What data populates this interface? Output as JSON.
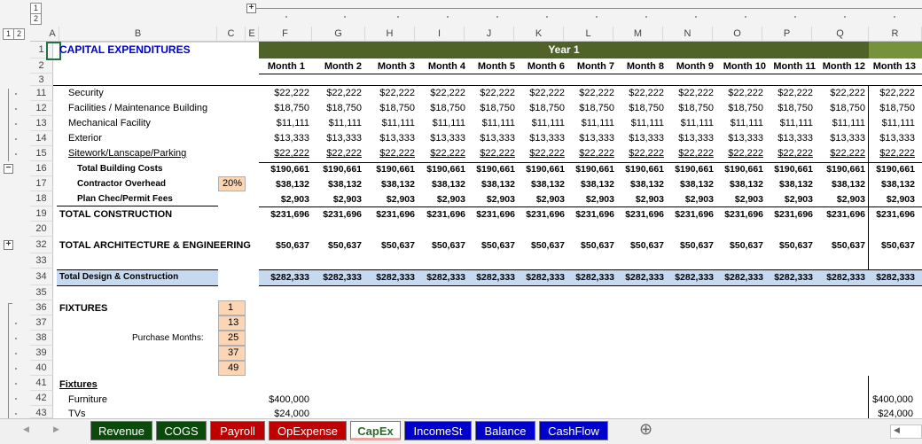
{
  "outline": {
    "col_levels": [
      "1",
      "2"
    ],
    "row_levels": [
      "1",
      "2"
    ],
    "expand": "+",
    "collapse": "−"
  },
  "columns": {
    "letters": [
      "A",
      "B",
      "C",
      "E",
      "F",
      "G",
      "H",
      "I",
      "J",
      "K",
      "L",
      "M",
      "N",
      "O",
      "P",
      "Q",
      "R"
    ]
  },
  "header": {
    "year_label": "Year 1",
    "months": [
      "Month 1",
      "Month 2",
      "Month 3",
      "Month 4",
      "Month 5",
      "Month 6",
      "Month 7",
      "Month 8",
      "Month 9",
      "Month 10",
      "Month 11",
      "Month 12",
      "Month 13"
    ]
  },
  "title": "CAPITAL EXPENDITURES",
  "rows": [
    {
      "num": "11",
      "label": "Security",
      "vals": [
        "$22,222",
        "$22,222",
        "$22,222",
        "$22,222",
        "$22,222",
        "$22,222",
        "$22,222",
        "$22,222",
        "$22,222",
        "$22,222",
        "$22,222",
        "$22,222",
        "$22,222"
      ]
    },
    {
      "num": "12",
      "label": "Facilities / Maintenance Building",
      "vals": [
        "$18,750",
        "$18,750",
        "$18,750",
        "$18,750",
        "$18,750",
        "$18,750",
        "$18,750",
        "$18,750",
        "$18,750",
        "$18,750",
        "$18,750",
        "$18,750",
        "$18,750"
      ]
    },
    {
      "num": "13",
      "label": "Mechanical Facility",
      "vals": [
        "$11,111",
        "$11,111",
        "$11,111",
        "$11,111",
        "$11,111",
        "$11,111",
        "$11,111",
        "$11,111",
        "$11,111",
        "$11,111",
        "$11,111",
        "$11,111",
        "$11,111"
      ]
    },
    {
      "num": "14",
      "label": "Exterior",
      "vals": [
        "$13,333",
        "$13,333",
        "$13,333",
        "$13,333",
        "$13,333",
        "$13,333",
        "$13,333",
        "$13,333",
        "$13,333",
        "$13,333",
        "$13,333",
        "$13,333",
        "$13,333"
      ]
    },
    {
      "num": "15",
      "label": "Sitework/Lanscape/Parking",
      "vals": [
        "$22,222",
        "$22,222",
        "$22,222",
        "$22,222",
        "$22,222",
        "$22,222",
        "$22,222",
        "$22,222",
        "$22,222",
        "$22,222",
        "$22,222",
        "$22,222",
        "$22,222"
      ]
    },
    {
      "num": "16",
      "label": "Total Building Costs",
      "vals": [
        "$190,661",
        "$190,661",
        "$190,661",
        "$190,661",
        "$190,661",
        "$190,661",
        "$190,661",
        "$190,661",
        "$190,661",
        "$190,661",
        "$190,661",
        "$190,661",
        "$190,661"
      ]
    },
    {
      "num": "17",
      "label": "Contractor Overhead",
      "input": "20%",
      "vals": [
        "$38,132",
        "$38,132",
        "$38,132",
        "$38,132",
        "$38,132",
        "$38,132",
        "$38,132",
        "$38,132",
        "$38,132",
        "$38,132",
        "$38,132",
        "$38,132",
        "$38,132"
      ]
    },
    {
      "num": "18",
      "label": "Plan Chec/Permit Fees",
      "vals": [
        "$2,903",
        "$2,903",
        "$2,903",
        "$2,903",
        "$2,903",
        "$2,903",
        "$2,903",
        "$2,903",
        "$2,903",
        "$2,903",
        "$2,903",
        "$2,903",
        "$2,903"
      ]
    },
    {
      "num": "19",
      "label": "TOTAL CONSTRUCTION",
      "vals": [
        "$231,696",
        "$231,696",
        "$231,696",
        "$231,696",
        "$231,696",
        "$231,696",
        "$231,696",
        "$231,696",
        "$231,696",
        "$231,696",
        "$231,696",
        "$231,696",
        "$231,696"
      ]
    },
    {
      "num": "32",
      "label": "TOTAL ARCHITECTURE & ENGINEERING",
      "vals": [
        "$50,637",
        "$50,637",
        "$50,637",
        "$50,637",
        "$50,637",
        "$50,637",
        "$50,637",
        "$50,637",
        "$50,637",
        "$50,637",
        "$50,637",
        "$50,637",
        "$50,637"
      ]
    },
    {
      "num": "34",
      "label": "Total Design & Construction",
      "vals": [
        "$282,333",
        "$282,333",
        "$282,333",
        "$282,333",
        "$282,333",
        "$282,333",
        "$282,333",
        "$282,333",
        "$282,333",
        "$282,333",
        "$282,333",
        "$282,333",
        "$282,333"
      ]
    }
  ],
  "row_numbers": [
    "1",
    "2",
    "3",
    "11",
    "12",
    "13",
    "14",
    "15",
    "16",
    "17",
    "18",
    "19",
    "20",
    "32",
    "33",
    "34",
    "35",
    "36",
    "37",
    "38",
    "39",
    "40",
    "41",
    "42",
    "43"
  ],
  "fixtures": {
    "label": "FIXTURES",
    "purchase_label": "Purchase Months:",
    "purchase_months": [
      "1",
      "13",
      "25",
      "37",
      "49"
    ],
    "section_label": "Fixtures",
    "furniture_label": "Furniture",
    "furniture_m1": "$400,000",
    "furniture_m13": "$400,000",
    "tvs_label": "TVs",
    "tvs_m1": "$24,000",
    "tvs_m13": "$24,000"
  },
  "tabs": [
    {
      "label": "Revenue",
      "color": "#0a4a0a",
      "active": false
    },
    {
      "label": "COGS",
      "color": "#0a4a0a",
      "active": false
    },
    {
      "label": "Payroll",
      "color": "#c00000",
      "active": false
    },
    {
      "label": "OpExpense",
      "color": "#c00000",
      "active": false
    },
    {
      "label": "CapEx",
      "color": "#e8a3a3",
      "active": true
    },
    {
      "label": "IncomeSt",
      "color": "#0000cc",
      "active": false
    },
    {
      "label": "Balance",
      "color": "#0000cc",
      "active": false
    },
    {
      "label": "CashFlow",
      "color": "#0000cc",
      "active": false
    }
  ],
  "nav": {
    "prev": "◀",
    "next": "▶",
    "add": "⊕"
  },
  "colors": {
    "year_green": "#4f6228",
    "month13_green": "#76933c",
    "input_orange": "#fcd5b4",
    "total_blue": "#c5d9f1",
    "title_blue": "#0000cc"
  }
}
